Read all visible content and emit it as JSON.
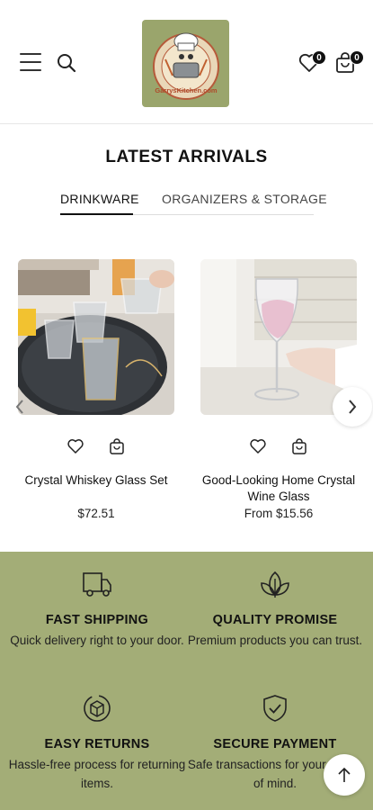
{
  "header": {
    "logo_text": "GarrysKitchen.com",
    "wishlist_count": "0",
    "cart_count": "0"
  },
  "section": {
    "title": "LATEST ARRIVALS",
    "tabs": [
      {
        "label": "DRINKWARE",
        "active": true
      },
      {
        "label": "ORGANIZERS & STORAGE",
        "active": false
      }
    ]
  },
  "products": [
    {
      "name": "Crystal Whiskey Glass Set",
      "price": "$72.51"
    },
    {
      "name": "Good-Looking Home Crystal Wine Glass",
      "price": "From $15.56"
    }
  ],
  "features": [
    {
      "icon": "truck-icon",
      "title": "FAST SHIPPING",
      "text": "Quick delivery right to your door."
    },
    {
      "icon": "leaf-icon",
      "title": "QUALITY PROMISE",
      "text": "Premium products you can trust."
    },
    {
      "icon": "returns-box-icon",
      "title": "EASY RETURNS",
      "text": "Hassle-free process for returning items."
    },
    {
      "icon": "shield-check-icon",
      "title": "SECURE PAYMENT",
      "text": "Safe transactions for your peace of mind."
    }
  ],
  "colors": {
    "feature_bg": "#a3ad77",
    "logo_bg": "#9aa56c",
    "badge": "#111111"
  }
}
